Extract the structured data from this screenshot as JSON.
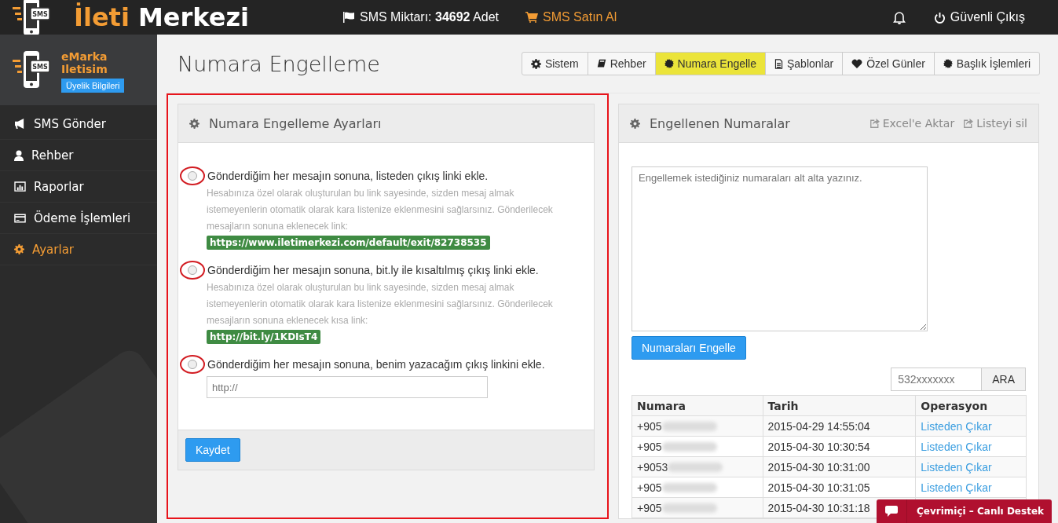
{
  "top_bar": {
    "logo_icon_text": "SMS",
    "logo_part_1": "İleti",
    "logo_part_2": "Merkezi",
    "sms_amount_label": "SMS Miktarı:",
    "sms_amount": "34692",
    "sms_amount_unit": "Adet",
    "buy_link": "SMS Satın Al",
    "logout": "Güvenli Çıkış"
  },
  "profile": {
    "icon_text": "SMS",
    "name_line_1": "eMarka",
    "name_line_2": "Iletisim",
    "button": "Üyelik Bilgileri"
  },
  "sidebar": {
    "items": [
      {
        "label": "SMS Gönder",
        "selected": false
      },
      {
        "label": "Rehber",
        "selected": false
      },
      {
        "label": "Raporlar",
        "selected": false
      },
      {
        "label": "Ödeme İşlemleri",
        "selected": false
      },
      {
        "label": "Ayarlar",
        "selected": true
      }
    ]
  },
  "page_title": "Numara Engelleme",
  "tabs": [
    {
      "label": "Sistem",
      "selected": false
    },
    {
      "label": "Rehber",
      "selected": false
    },
    {
      "label": "Numara Engelle",
      "selected": true
    },
    {
      "label": "Şablonlar",
      "selected": false
    },
    {
      "label": "Özel Günler",
      "selected": false
    },
    {
      "label": "Başlık İşlemleri",
      "selected": false
    }
  ],
  "settings_panel": {
    "title": "Numara Engelleme Ayarları",
    "options": [
      {
        "kind": "link",
        "label": "Gönderdiğim her mesajın sonuna, listeden çıkış linki ekle.",
        "description": "Hesabınıza özel olarak oluşturulan bu link sayesinde, sizden mesaj almak istemeyenlerin otomatik olarak kara listenize eklenmesini sağlarsınız. Gönderilecek mesajların sonuna eklenecek link:",
        "link": "https://www.iletimerkezi.com/default/exit/82738535",
        "selected": false
      },
      {
        "kind": "link",
        "label": "Gönderdiğim her mesajın sonuna, bit.ly ile kısaltılmış çıkış linki ekle.",
        "description": "Hesabınıza özel olarak oluşturulan bu link sayesinde, sizden mesaj almak istemeyenlerin otomatik olarak kara listenize eklenmesini sağlarsınız. Gönderilecek mesajların sonuna eklenecek kısa link:",
        "link": "http://bit.ly/1KDIsT4",
        "selected": false
      },
      {
        "kind": "input",
        "label": "Gönderdiğim her mesajın sonuna, benim yazacağım çıkış linkini ekle.",
        "placeholder": "http://",
        "selected": false
      }
    ],
    "save_button": "Kaydet"
  },
  "blocked_panel": {
    "title": "Engellenen Numaralar",
    "actions": [
      "Excel'e Aktar",
      "Listeyi sil"
    ],
    "textarea_placeholder": "Engellemek istediğiniz numaraları alt alta yazınız.",
    "block_button": "Numaraları Engelle",
    "search_placeholder": "532xxxxxxx",
    "search_button": "ARA",
    "table": {
      "columns": [
        "Numara",
        "Tarih",
        "Operasyon"
      ],
      "rows": [
        {
          "number": "+905",
          "date": "2015-04-29 14:55:04",
          "action": "Listeden Çıkar"
        },
        {
          "number": "+905",
          "date": "2015-04-30 10:30:54",
          "action": "Listeden Çıkar"
        },
        {
          "number": "+9053",
          "date": "2015-04-30 10:31:00",
          "action": "Listeden Çıkar"
        },
        {
          "number": "+905",
          "date": "2015-04-30 10:31:05",
          "action": "Listeden Çıkar"
        },
        {
          "number": "+905",
          "date": "2015-04-30 10:31:18"
        }
      ]
    }
  },
  "chat_widget": {
    "label": "Çevrimiçi – Canlı Destek"
  }
}
